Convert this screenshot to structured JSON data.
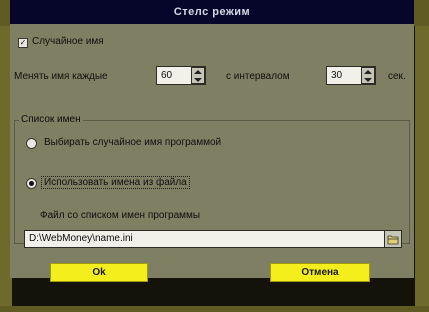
{
  "window": {
    "title": "Стелс режим"
  },
  "random_name": {
    "checked": true,
    "label": "Случайное имя"
  },
  "change_row": {
    "label_before": "Менять имя каждые",
    "every_value": "60",
    "label_middle": "с интервалом",
    "interval_value": "30",
    "unit": "сек."
  },
  "names_list": {
    "group_label": "Список имен",
    "option_random": "Выбирать случайное имя программой",
    "option_file": "Использовать имена из файла",
    "selected": "file",
    "file_label": "Файл со списком имен программы",
    "file_path": "D:\\WebMoney\\name.ini"
  },
  "buttons": {
    "ok": "Ok",
    "cancel": "Отмена"
  },
  "colors": {
    "button_bg": "#f4ee1c",
    "title_bg": "#05062a",
    "dialog_bg": "#7f7f63"
  }
}
